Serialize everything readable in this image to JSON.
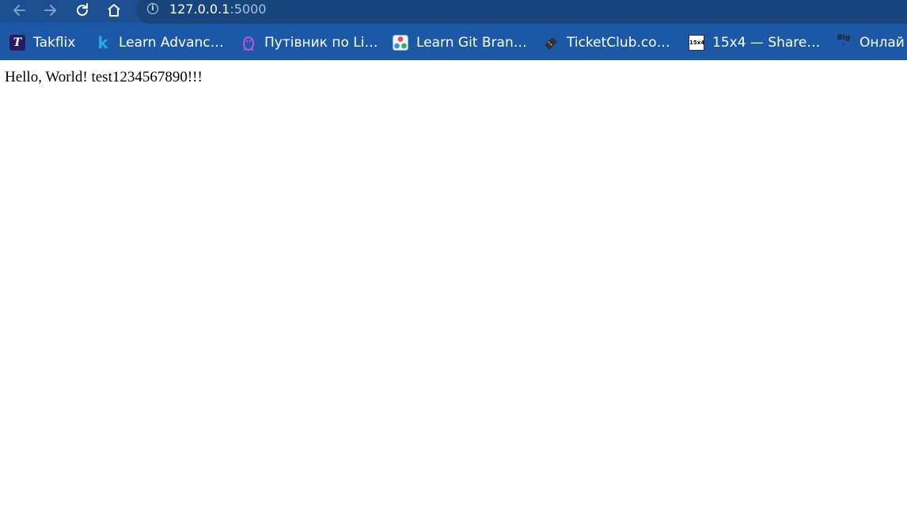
{
  "browser": {
    "url_host": "127.0.0.1",
    "url_port": ":5000",
    "nav": {
      "back_icon": "arrow-left-icon",
      "forward_icon": "arrow-right-icon",
      "reload_icon": "reload-icon",
      "home_icon": "home-icon"
    },
    "colors": {
      "chrome_bg": "#1b59a6",
      "toolbar_bg": "#1c4f90",
      "omnibox_bg": "#19457d"
    }
  },
  "bookmarks": [
    {
      "label": "Takflix",
      "icon": "takflix-icon"
    },
    {
      "label": "Learn Advanc…",
      "icon": "k-icon"
    },
    {
      "label": "Путівник по Li…",
      "icon": "penguin-icon"
    },
    {
      "label": "Learn Git Bran…",
      "icon": "git-icon"
    },
    {
      "label": "TicketClub.co…",
      "icon": "ticket-icon"
    },
    {
      "label": "15x4 — Share…",
      "icon": "15x4-icon"
    },
    {
      "label": "Онлай",
      "icon": "big-short-icon"
    }
  ],
  "page": {
    "body_text": "Hello, World! test1234567890!!!"
  }
}
